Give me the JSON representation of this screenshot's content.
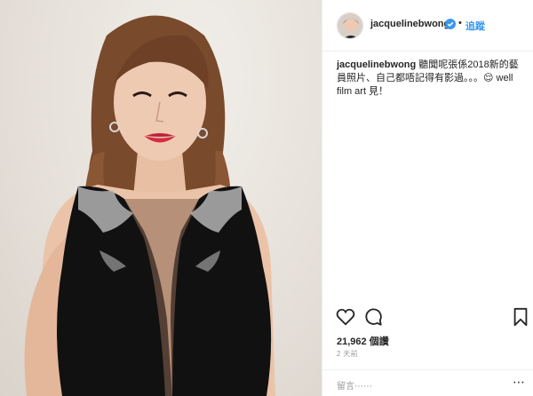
{
  "post": {
    "username": "jacquelinebwong",
    "follow_label": "追蹤",
    "separator": "•",
    "caption_user": "jacquelinebwong",
    "caption_text": " 聽聞呢張係2018新的藝員照片、自己都唔記得有影過。。。😌 well film art 見！",
    "likes": "21,962 個讚",
    "timestamp": "2 天前",
    "comment_placeholder": "留言⋯⋯",
    "more_symbol": "⋯"
  },
  "icons": {
    "verified": "verified-badge-icon",
    "like": "heart-icon",
    "comment": "comment-icon",
    "save": "bookmark-icon"
  },
  "colors": {
    "accent": "#3897f0",
    "text": "#262626",
    "muted": "#999999",
    "divider": "#efefef"
  }
}
